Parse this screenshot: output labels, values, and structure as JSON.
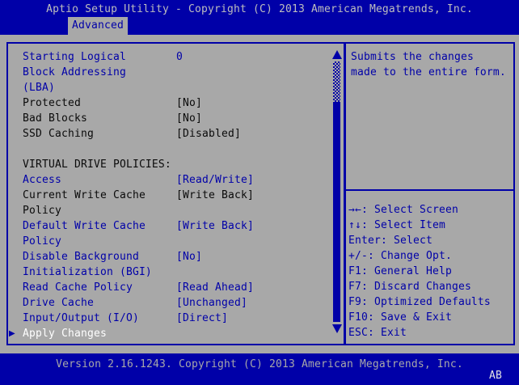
{
  "colors": {
    "blue": "#0000A8",
    "gray": "#A8A8A8",
    "black": "#0A0A0A",
    "white": "#FFFFFF",
    "header_text": "#BEBEBE"
  },
  "icons": {
    "submenu_arrow": "▶",
    "scroll_up": "▲",
    "scroll_down": "▼"
  },
  "header": {
    "title": "Aptio Setup Utility - Copyright (C) 2013 American Megatrends, Inc.",
    "tab": "Advanced"
  },
  "settings": {
    "rows": [
      {
        "label": "Starting Logical",
        "value": "0"
      },
      {
        "label": "Block Addressing",
        "value": ""
      },
      {
        "label": "(LBA)",
        "value": ""
      },
      {
        "label": "Protected",
        "value": "[No]"
      },
      {
        "label": "Bad Blocks",
        "value": "[No]"
      },
      {
        "label": "SSD Caching",
        "value": "[Disabled]"
      },
      {
        "label": "VIRTUAL DRIVE POLICIES:",
        "value": ""
      },
      {
        "label": "Access",
        "value": "[Read/Write]"
      },
      {
        "label": "Current Write Cache",
        "value": "[Write Back]"
      },
      {
        "label": "Policy",
        "value": ""
      },
      {
        "label": "Default Write Cache",
        "value": "[Write Back]"
      },
      {
        "label": "Policy",
        "value": ""
      },
      {
        "label": "Disable Background",
        "value": "[No]"
      },
      {
        "label": "Initialization (BGI)",
        "value": ""
      },
      {
        "label": "Read Cache Policy",
        "value": "[Read Ahead]"
      },
      {
        "label": "Drive Cache",
        "value": "[Unchanged]"
      },
      {
        "label": "Input/Output (I/O)",
        "value": "[Direct]"
      },
      {
        "label": "Apply Changes",
        "value": ""
      }
    ]
  },
  "help": {
    "description_lines": [
      "Submits the changes",
      "made to the entire form."
    ],
    "shortcuts": [
      "→←: Select Screen",
      "↑↓: Select Item",
      "Enter: Select",
      "+/-: Change Opt.",
      "F1: General Help",
      "F7: Discard Changes",
      "F9: Optimized Defaults",
      "F10: Save & Exit",
      "ESC: Exit"
    ]
  },
  "footer": {
    "version_line": "Version 2.16.1243. Copyright (C) 2013 American Megatrends, Inc.",
    "badge": "AB"
  }
}
